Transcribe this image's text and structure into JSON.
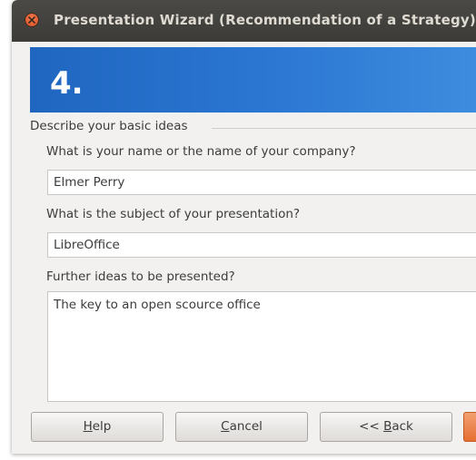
{
  "window": {
    "title": "Presentation Wizard (Recommendation of a Strategy)"
  },
  "banner": {
    "step": "4."
  },
  "group": {
    "label": "Describe your basic ideas"
  },
  "fields": {
    "name_label": "What is your name or the name of your company?",
    "name_value": "Elmer Perry",
    "subject_label": "What is the subject of your presentation?",
    "subject_value": "LibreOffice",
    "ideas_label": "Further ideas to be presented?",
    "ideas_value": "The key to an open scource office"
  },
  "buttons": {
    "help_mnemonic": "H",
    "help_rest": "elp",
    "cancel_mnemonic": "C",
    "cancel_rest": "ancel",
    "back_prefix": "<< ",
    "back_mnemonic": "B",
    "back_rest": "ack"
  },
  "colors": {
    "banner": "#2c78d3",
    "titlebar": "#3c3b37",
    "close": "#e4592a",
    "next_button": "#e56f32"
  }
}
